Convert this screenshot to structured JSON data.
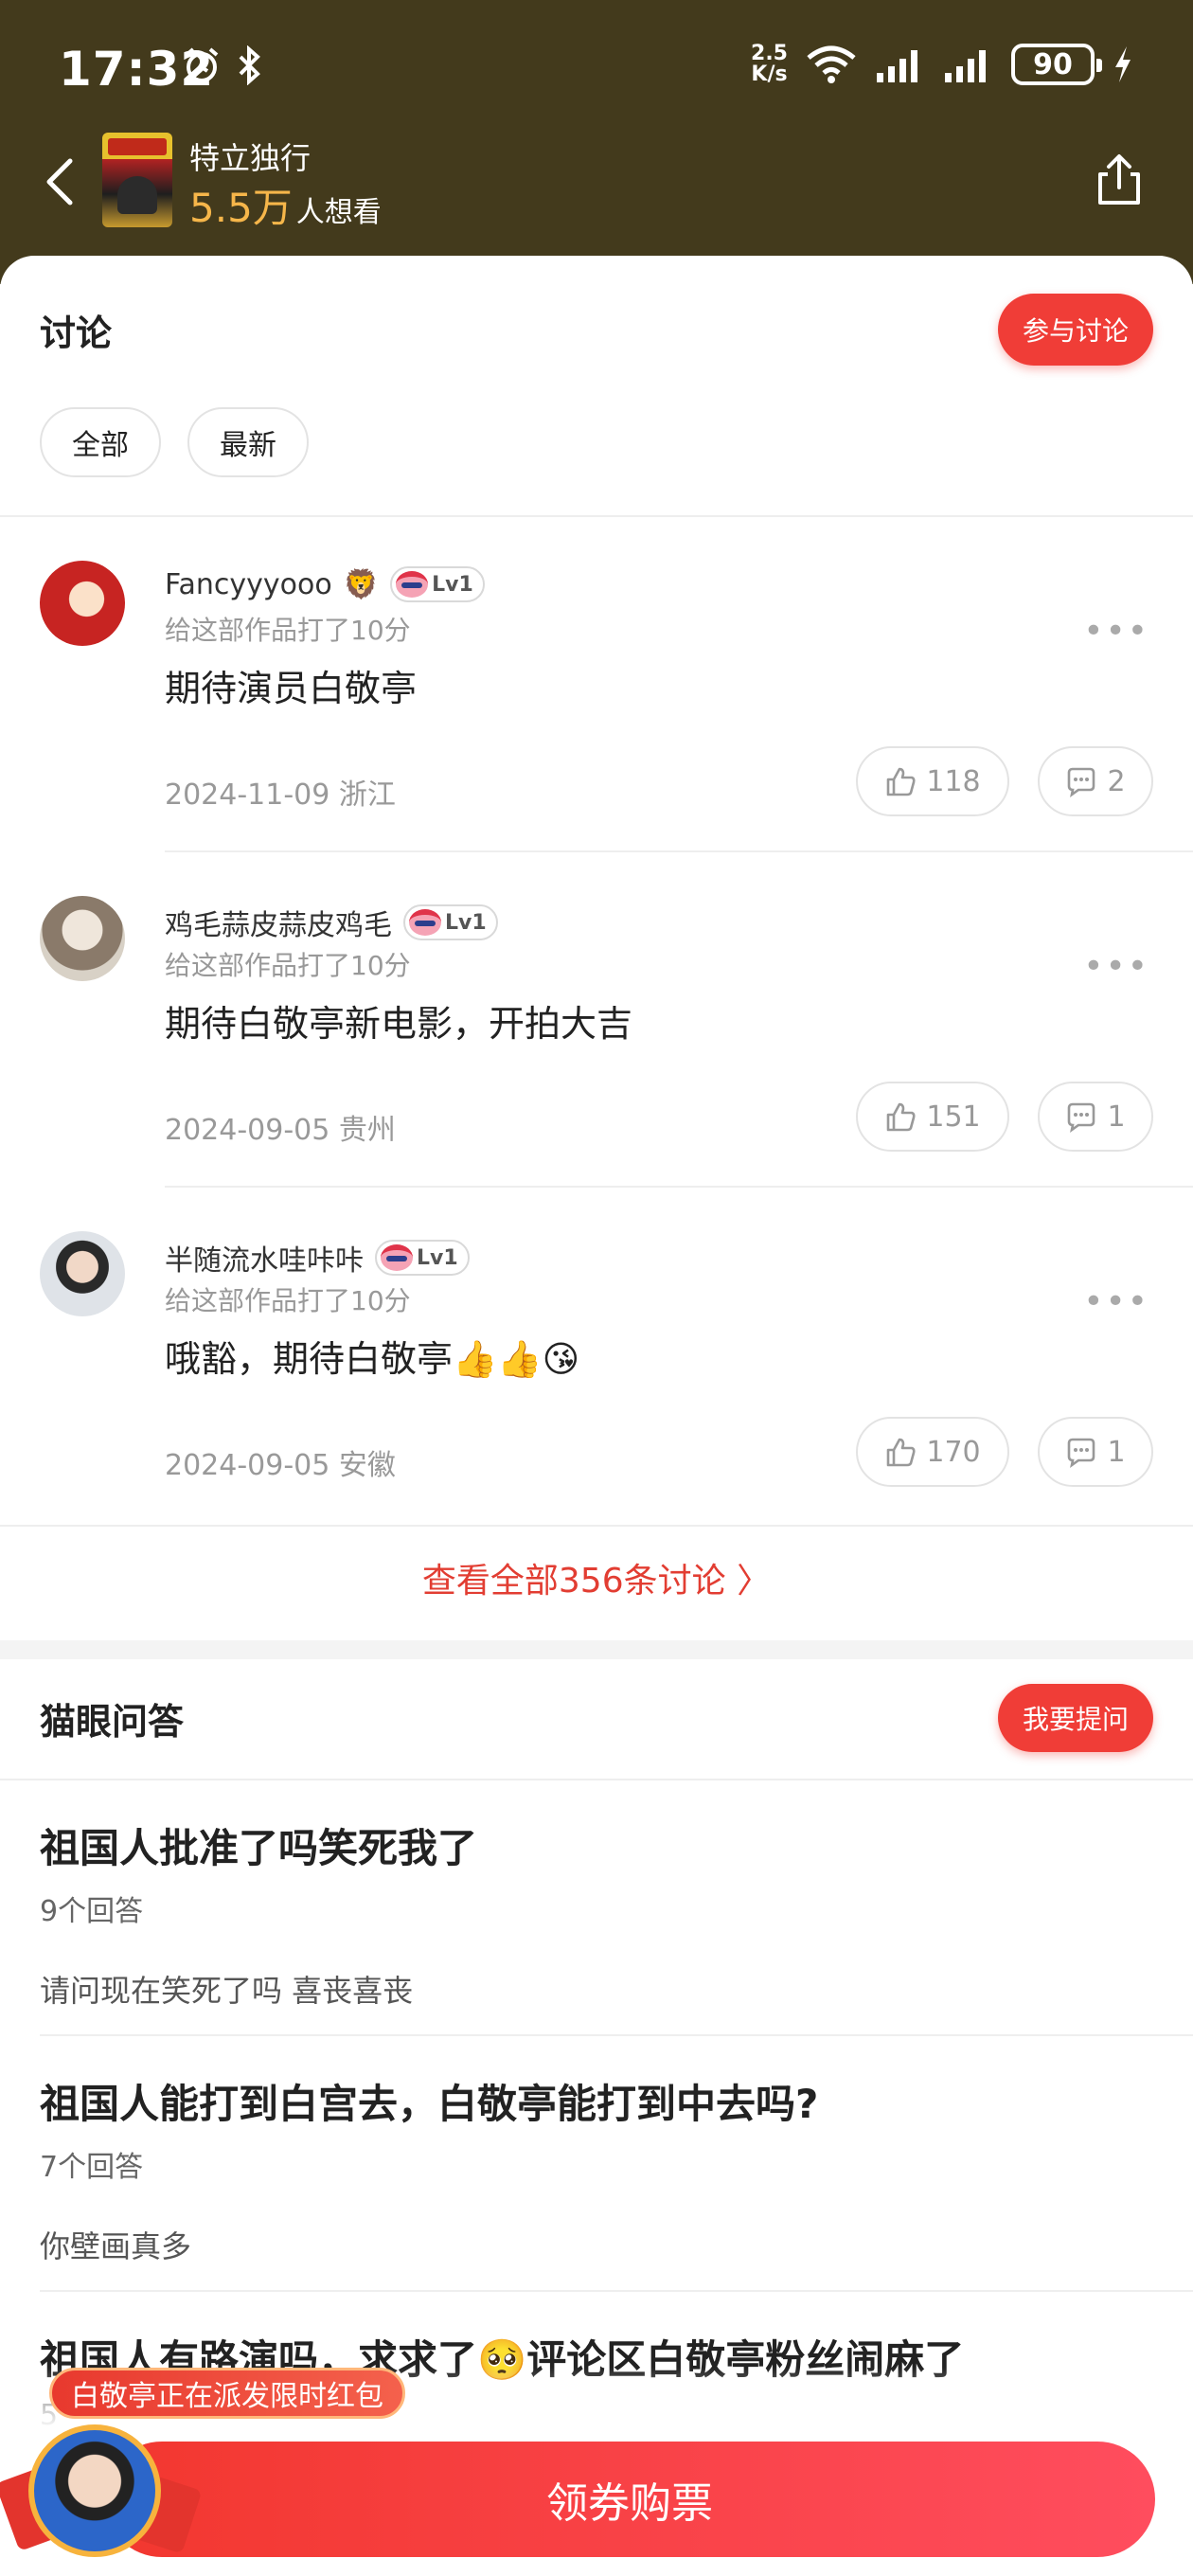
{
  "status_bar": {
    "time": "17:32",
    "net_speed_value": "2.5",
    "net_speed_unit": "K/s",
    "battery": "90",
    "icons": [
      "alarm-icon",
      "bluetooth-icon",
      "wifi-icon",
      "signal-icon",
      "signal-icon",
      "charging-icon"
    ]
  },
  "header": {
    "movie_title": "特立独行",
    "want_count": "5.5万",
    "want_label": "人想看"
  },
  "discussion": {
    "title": "讨论",
    "join_button": "参与讨论",
    "filters": [
      "全部",
      "最新"
    ],
    "comments": [
      {
        "user": "Fancyyyooo",
        "user_emoji": "🦁",
        "level": "Lv1",
        "score_text": "给这部作品打了10分",
        "text": "期待演员白敬亭",
        "date_location": "2024-11-09 浙江",
        "likes": "118",
        "replies": "2"
      },
      {
        "user": "鸡毛蒜皮蒜皮鸡毛",
        "user_emoji": "",
        "level": "Lv1",
        "score_text": "给这部作品打了10分",
        "text": "期待白敬亭新电影，开拍大吉",
        "date_location": "2024-09-05 贵州",
        "likes": "151",
        "replies": "1"
      },
      {
        "user": "半随流水哇咔咔",
        "user_emoji": "",
        "level": "Lv1",
        "score_text": "给这部作品打了10分",
        "text": "哦豁，期待白敬亭👍👍😘",
        "date_location": "2024-09-05 安徽",
        "likes": "170",
        "replies": "1"
      }
    ],
    "view_all": "查看全部356条讨论 〉"
  },
  "qa": {
    "title": "猫眼问答",
    "ask_button": "我要提问",
    "items": [
      {
        "question": "祖国人批准了吗笑死我了",
        "count": "9个回答",
        "answer": "请问现在笑死了吗 喜丧喜丧"
      },
      {
        "question": "祖国人能打到白宫去，白敬亭能打到中去吗?",
        "count": "7个回答",
        "answer": "你壁画真多"
      },
      {
        "question": "祖国人有路演吗，求求了🥺评论区白敬亭粉丝闹麻了",
        "count": "5",
        "answer": ""
      }
    ]
  },
  "bottom": {
    "promo_text": "白敬亭正在派发限时红包",
    "buy_button": "领券购票"
  },
  "colors": {
    "header_bg": "#433a1c",
    "accent_red": "#f03d37",
    "want_orange": "#f6b64a"
  }
}
